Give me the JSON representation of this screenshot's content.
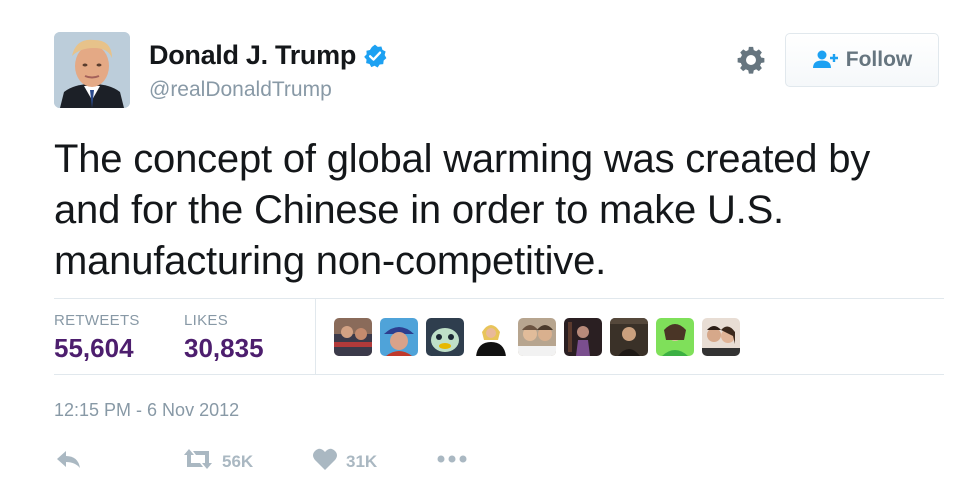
{
  "user": {
    "display_name": "Donald J. Trump",
    "handle": "@realDonaldTrump",
    "verified": true,
    "avatar_icon": "profile-photo"
  },
  "header": {
    "settings_icon": "gear-icon",
    "follow_label": "Follow",
    "follow_icon": "add-user-icon"
  },
  "tweet": {
    "text": "The concept of global warming was created by and for the Chinese in order to make U.S. manufacturing non-competitive.",
    "timestamp": "12:15 PM - 6 Nov 2012"
  },
  "stats": {
    "retweets_label": "RETWEETS",
    "retweets_value": "55,604",
    "likes_label": "LIKES",
    "likes_value": "30,835"
  },
  "actions": {
    "reply_icon": "reply-icon",
    "retweet_icon": "retweet-icon",
    "retweet_count": "56K",
    "like_icon": "heart-icon",
    "like_count": "31K",
    "more_icon": "more-dots-icon"
  },
  "colors": {
    "text": "#14171a",
    "muted": "#8899a6",
    "stat_value": "#4d1e6e",
    "verified_blue": "#1da1f2",
    "action_gray": "#aab8c2",
    "divider": "#e1e8ed"
  }
}
